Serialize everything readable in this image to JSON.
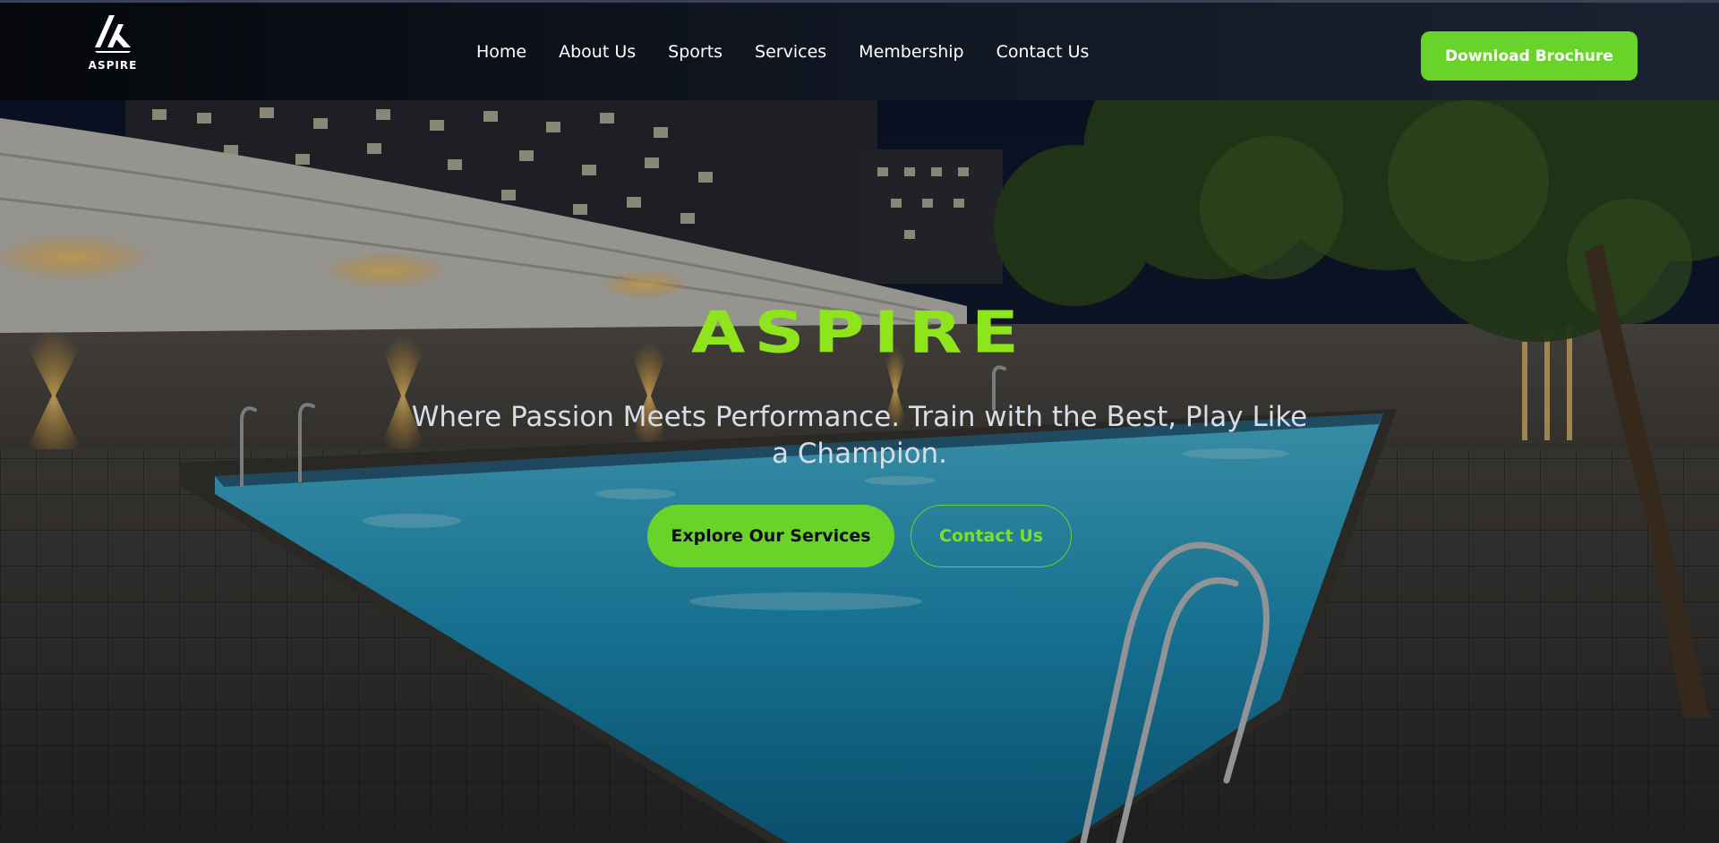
{
  "brand": {
    "logo_text": "ASPIRE",
    "logo_icon": "aspire-logo-icon",
    "accent_color": "#6ad32a",
    "title_color": "#8fe51c"
  },
  "nav": {
    "items": [
      {
        "label": "Home"
      },
      {
        "label": "About Us"
      },
      {
        "label": "Sports"
      },
      {
        "label": "Services"
      },
      {
        "label": "Membership"
      },
      {
        "label": "Contact Us"
      }
    ],
    "brochure_label": "Download Brochure"
  },
  "hero": {
    "title": "ASPIRE",
    "subtitle": "Where Passion Meets Performance. Train with the Best, Play Like a Champion.",
    "primary_cta": "Explore Our Services",
    "secondary_cta": "Contact Us",
    "background": "night swimming pool with lit canopy and apartment buildings"
  }
}
